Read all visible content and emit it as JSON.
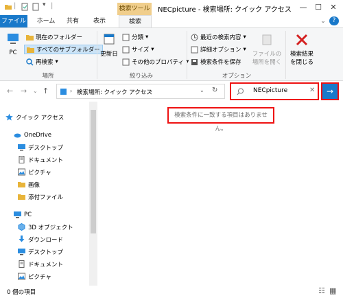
{
  "window": {
    "context_tab_header": "検索ツール",
    "title": "NECpicture - 検索場所: クイック アクセス"
  },
  "tabs": {
    "file": "ファイル",
    "home": "ホーム",
    "share": "共有",
    "view": "表示",
    "search": "検索"
  },
  "ribbon": {
    "location": {
      "pc": "PC",
      "current_folder": "現在のフォルダー",
      "all_subfolders": "すべてのサブフォルダー",
      "search_again": "再検索",
      "label": "場所"
    },
    "refine": {
      "date_modified": "更新日",
      "kind": "分類",
      "size": "サイズ",
      "other_properties": "その他のプロパティ",
      "label": "絞り込み"
    },
    "options": {
      "recent_searches": "最近の検索内容",
      "advanced_options": "詳細オプション",
      "save_search": "検索条件を保存",
      "open_location": "ファイルの場所を開く",
      "open_location_l1": "ファイルの",
      "open_location_l2": "場所を開く",
      "label": "オプション"
    },
    "close": {
      "close_l1": "検索結果",
      "close_l2": "を閉じる"
    }
  },
  "address": {
    "path": "検索場所: クイック アクセス"
  },
  "search": {
    "value": "NECpicture"
  },
  "navpane": {
    "items": [
      {
        "label": "クイック アクセス",
        "icon": "star-icon"
      },
      {
        "label": "OneDrive",
        "icon": "cloud-icon"
      },
      {
        "label": "デスクトップ",
        "icon": "desktop-icon"
      },
      {
        "label": "ドキュメント",
        "icon": "document-icon"
      },
      {
        "label": "ピクチャ",
        "icon": "picture-icon"
      },
      {
        "label": "画像",
        "icon": "folder-icon"
      },
      {
        "label": "添付ファイル",
        "icon": "folder-icon"
      },
      {
        "label": "PC",
        "icon": "pc-icon"
      },
      {
        "label": "3D オブジェクト",
        "icon": "cube-icon"
      },
      {
        "label": "ダウンロード",
        "icon": "download-icon"
      },
      {
        "label": "デスクトップ",
        "icon": "desktop-icon"
      },
      {
        "label": "ドキュメント",
        "icon": "document-icon"
      },
      {
        "label": "ピクチャ",
        "icon": "picture-icon"
      }
    ]
  },
  "content": {
    "empty_message": "検索条件に一致する項目はありません。"
  },
  "status": {
    "item_count": "0 個の項目"
  },
  "colors": {
    "accent": "#1979ca",
    "highlight_border": "#e11111",
    "context_tab": "#f0ce8c"
  }
}
